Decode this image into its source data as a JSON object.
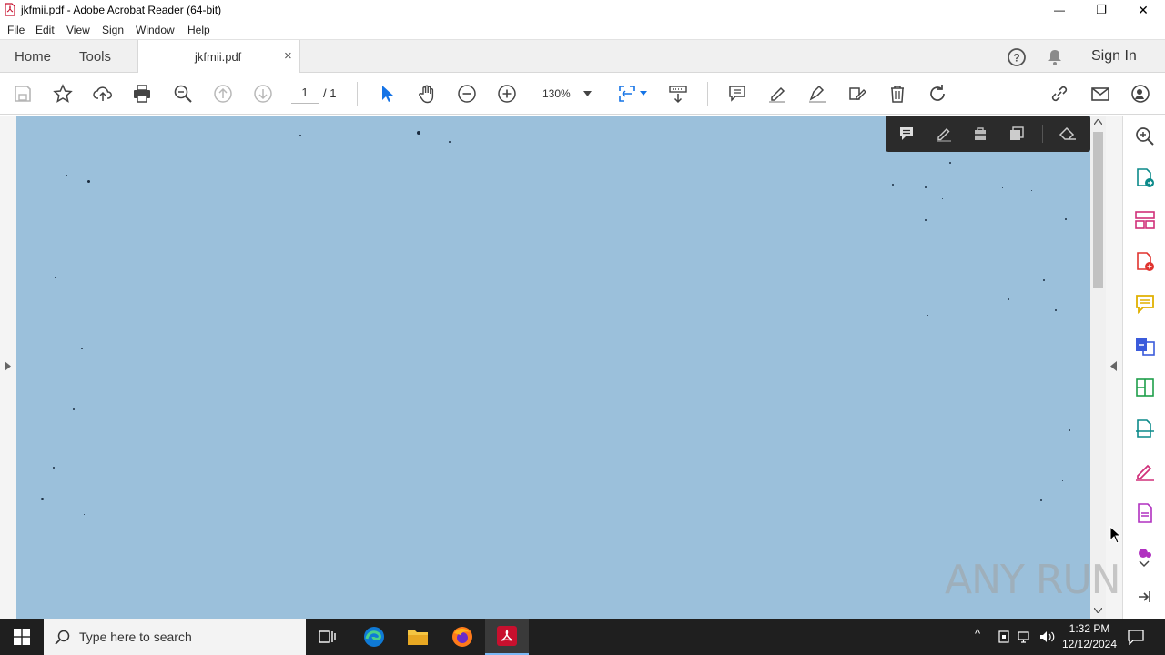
{
  "window": {
    "title": "jkfmii.pdf - Adobe Acrobat Reader (64-bit)",
    "controls": {
      "minimize": "—",
      "restore": "❐",
      "close": "✕"
    }
  },
  "menu": [
    "File",
    "Edit",
    "View",
    "Sign",
    "Window",
    "Help"
  ],
  "tabs": {
    "home": "Home",
    "tools": "Tools",
    "document": "jkfmii.pdf",
    "close": "×",
    "sign_in": "Sign In"
  },
  "toolbar": {
    "page_current": "1",
    "page_total": "/ 1",
    "zoom": "130%"
  },
  "watermark": "ANY RUN",
  "taskbar": {
    "search_placeholder": "Type here to search",
    "time": "1:32 PM",
    "date": "12/12/2024"
  },
  "colors": {
    "page_background": "#9bc0db",
    "accent_red": "#c8102e",
    "taskbar": "#1f1f1f"
  }
}
